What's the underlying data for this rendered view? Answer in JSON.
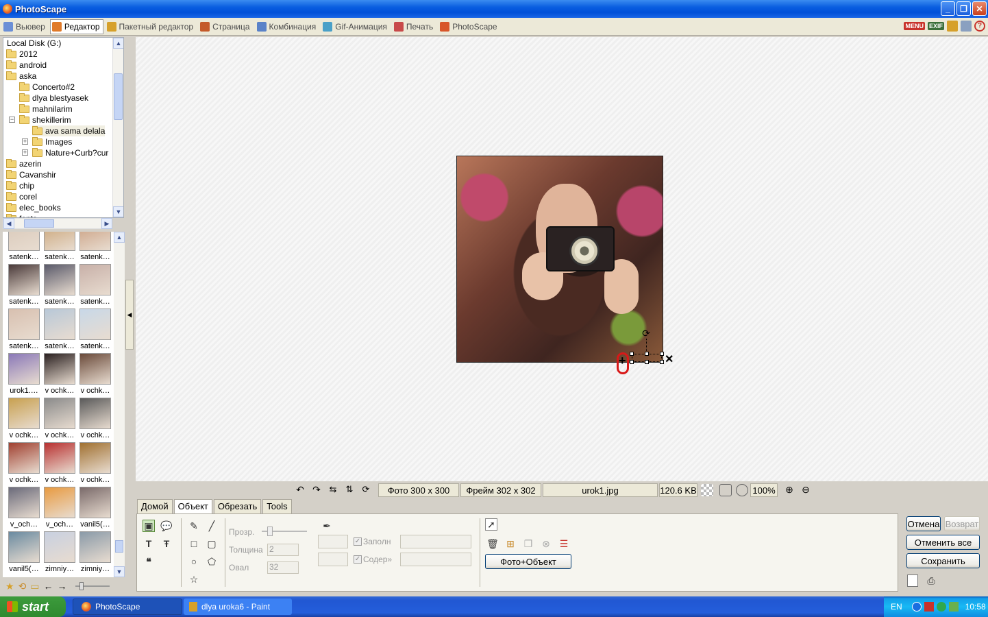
{
  "window": {
    "title": "PhotoScape",
    "controls": [
      "_",
      "❐",
      "✕"
    ]
  },
  "tabs": [
    {
      "label": "Вьювер",
      "color": "#6b8fd6"
    },
    {
      "label": "Редактор",
      "color": "#e07a2a"
    },
    {
      "label": "Пакетный редактор",
      "color": "#d6a02a"
    },
    {
      "label": "Страница",
      "color": "#c45a2a"
    },
    {
      "label": "Комбинация",
      "color": "#5a82c8"
    },
    {
      "label": "Gif-Анимация",
      "color": "#4aa0c8"
    },
    {
      "label": "Печать",
      "color": "#c84a4a"
    },
    {
      "label": "PhotoScape",
      "color": "#d8562a"
    }
  ],
  "active_tab": "Редактор",
  "top_right": {
    "menu": "MENU",
    "exif": "EXIF"
  },
  "tree": {
    "root": "Local Disk (G:)",
    "items": [
      "2012",
      "android",
      "aska",
      "Concerto#2",
      "dlya blestyasek",
      "mahnilarim",
      "shekillerim",
      "ava sama delala",
      "Images",
      "Nature+Curb?cur",
      "azerin",
      "Cavanshir",
      "chip",
      "corel",
      "elec_books",
      "fonts"
    ]
  },
  "thumbnails": [
    "satenk…",
    "satenk…",
    "satenk…",
    "satenk…",
    "satenk…",
    "satenk…",
    "satenk…",
    "satenk…",
    "satenk…",
    "urok1.…",
    "v ochk…",
    "v ochk…",
    "v ochk…",
    "v ochk…",
    "v ochk…",
    "v ochk…",
    "v ochk…",
    "v ochk…",
    "v_och…",
    "v_och…",
    "vanil5(…",
    "vanil5(…",
    "zimniy…",
    "zimniy…"
  ],
  "status": {
    "photo": "Фото 300 x 300",
    "frame": "Фрейм 302 x 302",
    "file": "urok1.jpg",
    "size": "120.6 KB",
    "zoom": "100%"
  },
  "subtabs": [
    "Домой",
    "Объект",
    "Обрезать",
    "Tools"
  ],
  "active_subtab": "Объект",
  "object_panel": {
    "opacity_label": "Прозр.",
    "thickness_label": "Толщина",
    "thickness_value": "2",
    "oval_label": "Овал",
    "oval_value": "32",
    "fill_label": "Заполн",
    "content_label": "Содер»",
    "photo_object_button": "Фото+Объект"
  },
  "actions": {
    "undo": "Отмена",
    "redo": "Возврат",
    "undo_all": "Отменить все",
    "save": "Сохранить"
  },
  "taskbar": {
    "start": "start",
    "tasks": [
      "PhotoScape",
      "dlya uroka6 - Paint"
    ],
    "lang": "EN",
    "time": "10:58"
  }
}
